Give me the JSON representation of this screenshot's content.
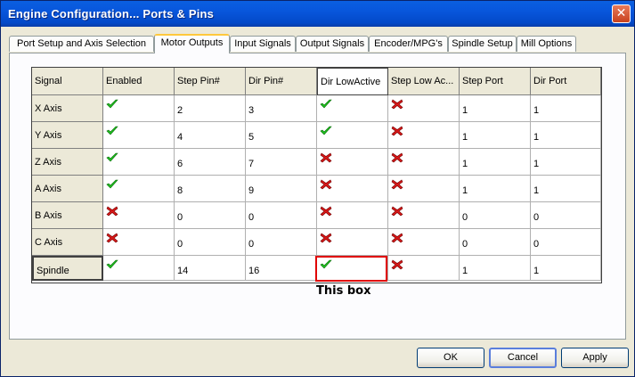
{
  "window": {
    "title": "Engine Configuration... Ports & Pins",
    "close_glyph": "✕"
  },
  "tabs": [
    {
      "label": "Port Setup and Axis Selection"
    },
    {
      "label": "Motor Outputs",
      "active": true
    },
    {
      "label": "Input Signals"
    },
    {
      "label": "Output Signals"
    },
    {
      "label": "Encoder/MPG's"
    },
    {
      "label": "Spindle Setup"
    },
    {
      "label": "Mill Options"
    }
  ],
  "grid": {
    "columns": [
      "Signal",
      "Enabled",
      "Step Pin#",
      "Dir Pin#",
      "Dir LowActive",
      "Step Low Ac...",
      "Step Port",
      "Dir Port"
    ],
    "rows": [
      {
        "signal": "X Axis",
        "enabled": "check",
        "step_pin": "2",
        "dir_pin": "3",
        "dir_low_active": "check",
        "step_low_active": "cross",
        "step_port": "1",
        "dir_port": "1"
      },
      {
        "signal": "Y Axis",
        "enabled": "check",
        "step_pin": "4",
        "dir_pin": "5",
        "dir_low_active": "check",
        "step_low_active": "cross",
        "step_port": "1",
        "dir_port": "1"
      },
      {
        "signal": "Z Axis",
        "enabled": "check",
        "step_pin": "6",
        "dir_pin": "7",
        "dir_low_active": "cross",
        "step_low_active": "cross",
        "step_port": "1",
        "dir_port": "1"
      },
      {
        "signal": "A Axis",
        "enabled": "check",
        "step_pin": "8",
        "dir_pin": "9",
        "dir_low_active": "cross",
        "step_low_active": "cross",
        "step_port": "1",
        "dir_port": "1"
      },
      {
        "signal": "B Axis",
        "enabled": "cross",
        "step_pin": "0",
        "dir_pin": "0",
        "dir_low_active": "cross",
        "step_low_active": "cross",
        "step_port": "0",
        "dir_port": "0"
      },
      {
        "signal": "C Axis",
        "enabled": "cross",
        "step_pin": "0",
        "dir_pin": "0",
        "dir_low_active": "cross",
        "step_low_active": "cross",
        "step_port": "0",
        "dir_port": "0"
      },
      {
        "signal": "Spindle",
        "enabled": "check",
        "step_pin": "14",
        "dir_pin": "16",
        "dir_low_active": "check",
        "step_low_active": "cross",
        "step_port": "1",
        "dir_port": "1"
      }
    ]
  },
  "annotation": {
    "text": "This box",
    "color": "#e00000"
  },
  "buttons": {
    "ok": "OK",
    "cancel": "Cancel",
    "apply": "Apply"
  },
  "colors": {
    "check": "#1ec41e",
    "cross": "#d81818",
    "title_bar": "#0856dc"
  }
}
